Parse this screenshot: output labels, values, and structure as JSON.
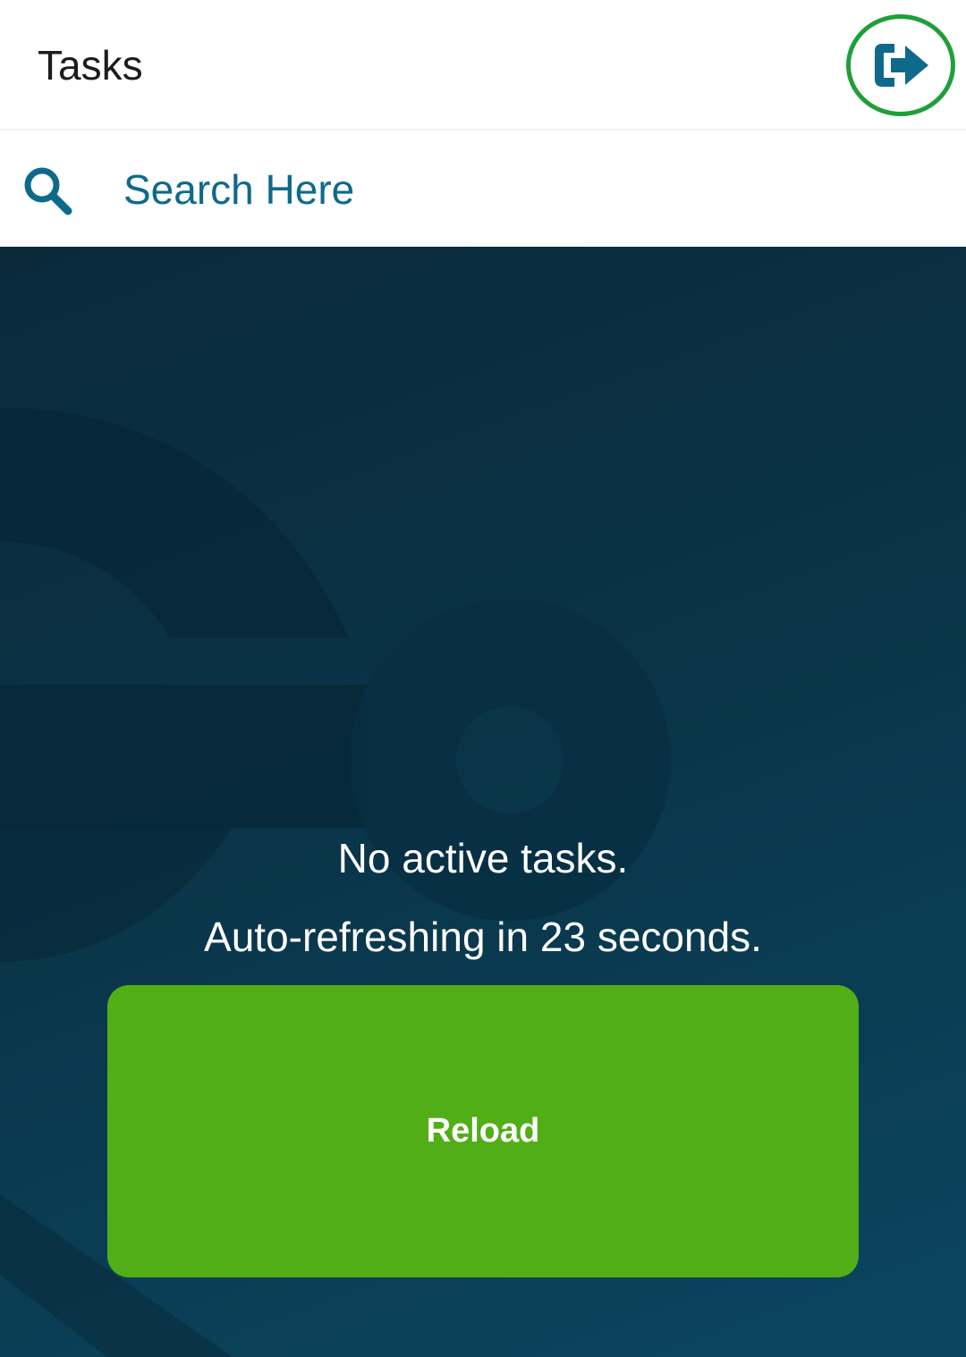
{
  "header": {
    "title": "Tasks",
    "logout_icon": "logout-arrow-icon",
    "highlight_color": "#1f9f3a",
    "icon_color": "#0e6a8a"
  },
  "search": {
    "icon": "search-icon",
    "placeholder": "Search Here"
  },
  "main": {
    "empty_message": "No active tasks.",
    "refresh_message": "Auto-refreshing in 23 seconds.",
    "reload_label": "Reload",
    "reload_color": "#52ae17"
  }
}
